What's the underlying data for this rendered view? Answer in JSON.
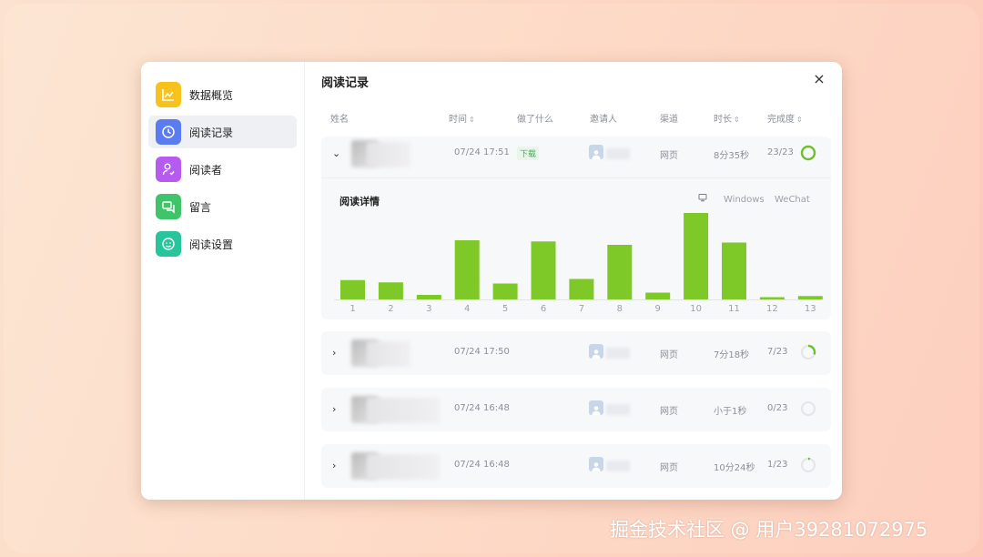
{
  "sidebar": {
    "items": [
      {
        "label": "数据概览",
        "icon": "chart-icon",
        "color": "#f7c21c",
        "active": false
      },
      {
        "label": "阅读记录",
        "icon": "clock-icon",
        "color": "#5b7cf0",
        "active": true
      },
      {
        "label": "阅读者",
        "icon": "user-icon",
        "color": "#b65bf0",
        "active": false
      },
      {
        "label": "留言",
        "icon": "message-icon",
        "color": "#3fc46a",
        "active": false
      },
      {
        "label": "阅读设置",
        "icon": "smile-icon",
        "color": "#26c59b",
        "active": false
      }
    ]
  },
  "main": {
    "title": "阅读记录",
    "close": "×",
    "columns": [
      "姓名",
      "时间",
      "做了什么",
      "邀请人",
      "渠道",
      "时长",
      "完成度"
    ],
    "sortable": [
      "时间",
      "时长",
      "完成度"
    ]
  },
  "rows": [
    {
      "time": "07/24 17:51",
      "action": "下载",
      "channel": "网页",
      "duration": "8分35秒",
      "progress": "23/23",
      "fraction": 1.0,
      "expanded": true
    },
    {
      "time": "07/24 17:50",
      "action": "",
      "channel": "网页",
      "duration": "7分18秒",
      "progress": "7/23",
      "fraction": 0.304,
      "expanded": false
    },
    {
      "time": "07/24 16:48",
      "action": "",
      "channel": "网页",
      "duration": "小于1秒",
      "progress": "0/23",
      "fraction": 0.0,
      "expanded": false
    },
    {
      "time": "07/24 16:48",
      "action": "",
      "channel": "网页",
      "duration": "10分24秒",
      "progress": "1/23",
      "fraction": 0.043,
      "expanded": false
    }
  ],
  "detail": {
    "title": "阅读详情",
    "legend": [
      "Windows",
      "WeChat"
    ]
  },
  "chart_data": {
    "type": "bar",
    "categories": [
      "1",
      "2",
      "3",
      "4",
      "5",
      "6",
      "7",
      "8",
      "9",
      "10",
      "11",
      "12",
      "13"
    ],
    "values": [
      17,
      15,
      4,
      52,
      14,
      51,
      18,
      48,
      6,
      76,
      50,
      2,
      3
    ],
    "color": "#7ec927",
    "ylim": [
      0,
      80
    ]
  },
  "watermark": "掘金技术社区 @ 用户39281072975"
}
